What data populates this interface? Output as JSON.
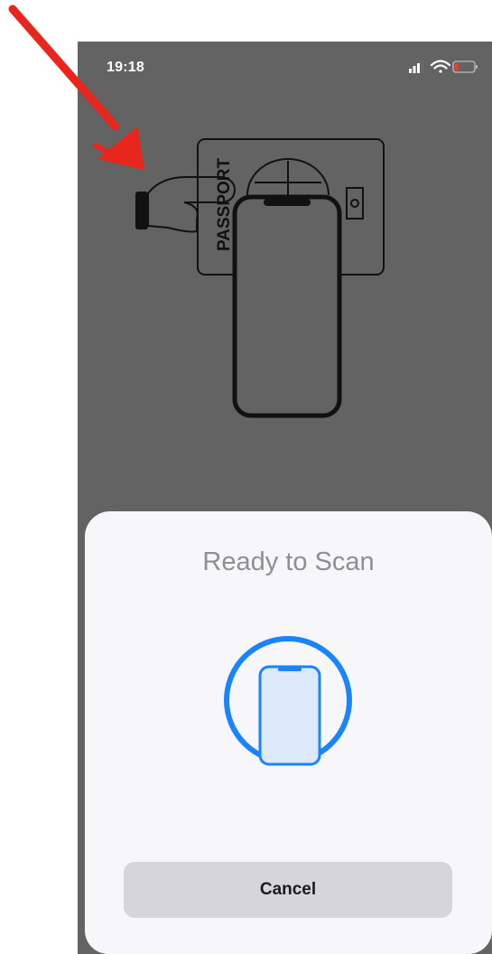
{
  "status_bar": {
    "time": "19:18",
    "icons": [
      "cellular-signal-icon",
      "wifi-icon",
      "battery-low-icon"
    ]
  },
  "illustration": {
    "passport_label": "PASSPORT",
    "icons": [
      "hand-icon",
      "passport-icon",
      "phone-outline-icon"
    ]
  },
  "scan_sheet": {
    "title": "Ready to Scan",
    "icon": "phone-scan-icon",
    "cancel_label": "Cancel"
  },
  "annotation": {
    "icon": "red-arrow-icon",
    "color": "#e8261c"
  },
  "colors": {
    "background_dim": "#636363",
    "sheet": "#f7f7f9",
    "accent_blue": "#1a84ff",
    "button_gray": "#d5d5da"
  }
}
